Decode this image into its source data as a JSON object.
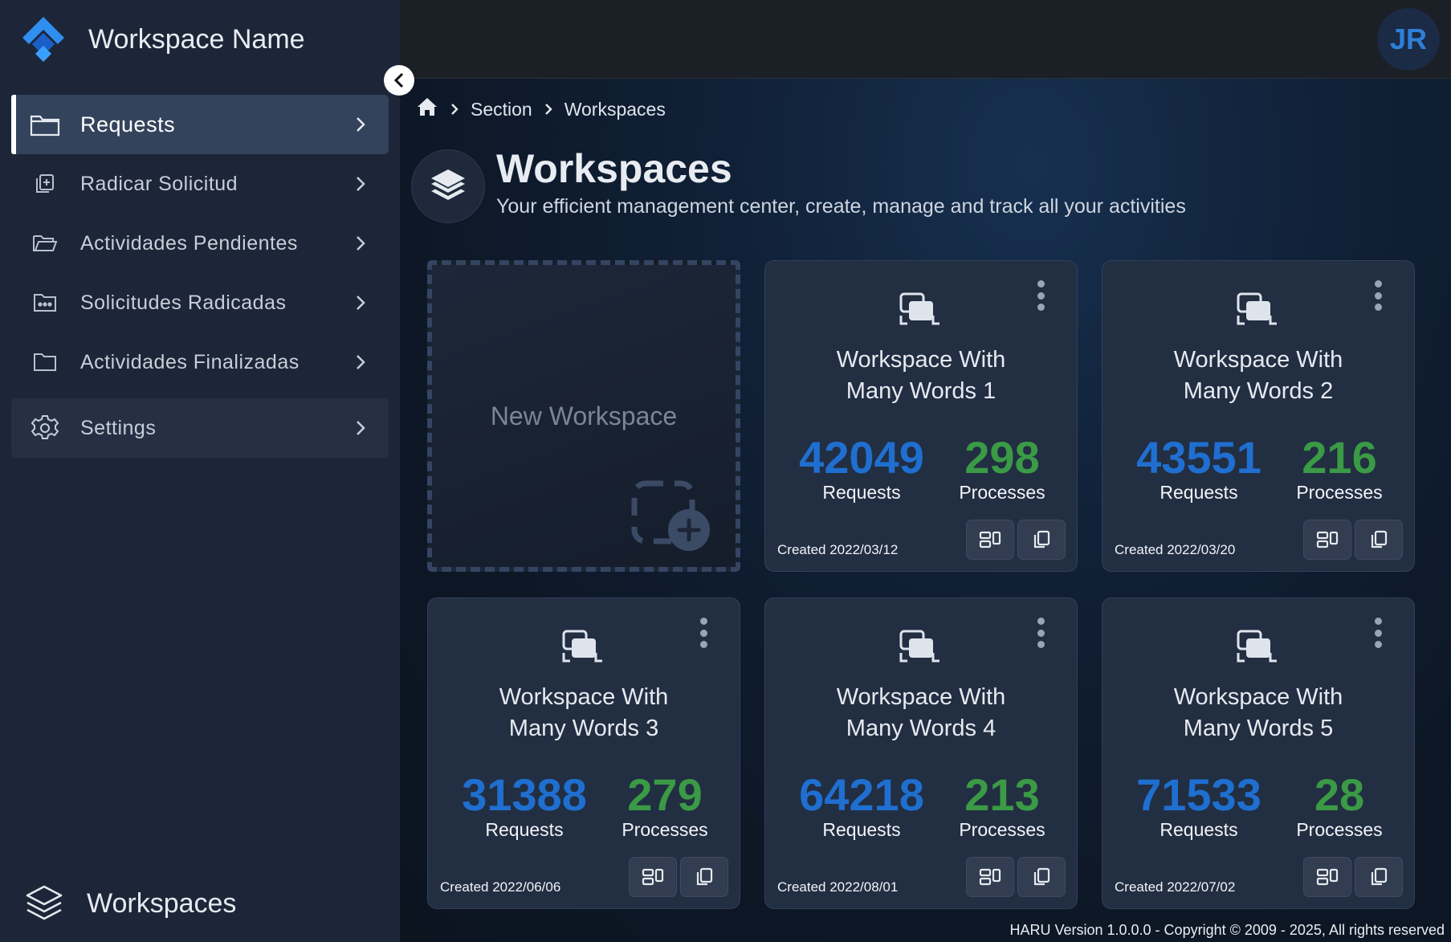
{
  "sidebar": {
    "brand_name": "Workspace Name",
    "items": [
      {
        "label": "Requests",
        "icon": "folder-icon"
      },
      {
        "label": "Radicar Solicitud",
        "icon": "file-add-icon"
      },
      {
        "label": "Actividades Pendientes",
        "icon": "folder-open-icon"
      },
      {
        "label": "Solicitudes Radicadas",
        "icon": "folder-dots-icon"
      },
      {
        "label": "Actividades Finalizadas",
        "icon": "folder-icon"
      },
      {
        "label": "Settings",
        "icon": "gear-icon"
      }
    ],
    "footer_label": "Workspaces"
  },
  "topbar": {
    "avatar_initials": "JR"
  },
  "breadcrumb": {
    "items": [
      "Section",
      "Workspaces"
    ]
  },
  "header": {
    "title": "Workspaces",
    "subtitle": "Your efficient management center, create, manage and track all your activities"
  },
  "new_workspace_label": "New Workspace",
  "labels": {
    "requests": "Requests",
    "processes": "Processes"
  },
  "workspaces": [
    {
      "name_line1": "Workspace With",
      "name_line2": "Many Words 1",
      "requests": "42049",
      "processes": "298",
      "created": "Created 2022/03/12"
    },
    {
      "name_line1": "Workspace With",
      "name_line2": "Many Words 2",
      "requests": "43551",
      "processes": "216",
      "created": "Created 2022/03/20"
    },
    {
      "name_line1": "Workspace With",
      "name_line2": "Many Words 3",
      "requests": "31388",
      "processes": "279",
      "created": "Created 2022/06/06"
    },
    {
      "name_line1": "Workspace With",
      "name_line2": "Many Words 4",
      "requests": "64218",
      "processes": "213",
      "created": "Created 2022/08/01"
    },
    {
      "name_line1": "Workspace With",
      "name_line2": "Many Words 5",
      "requests": "71533",
      "processes": "28",
      "created": "Created 2022/07/02"
    }
  ],
  "footer": {
    "copyright": "HARU Version 1.0.0.0 - Copyright © 2009 - 2025, All rights reserved"
  },
  "colors": {
    "requests_accent": "#1f6fd0",
    "processes_accent": "#3a9a45",
    "sidebar_bg": "#1c2638",
    "active_item_bg": "#33435c"
  }
}
